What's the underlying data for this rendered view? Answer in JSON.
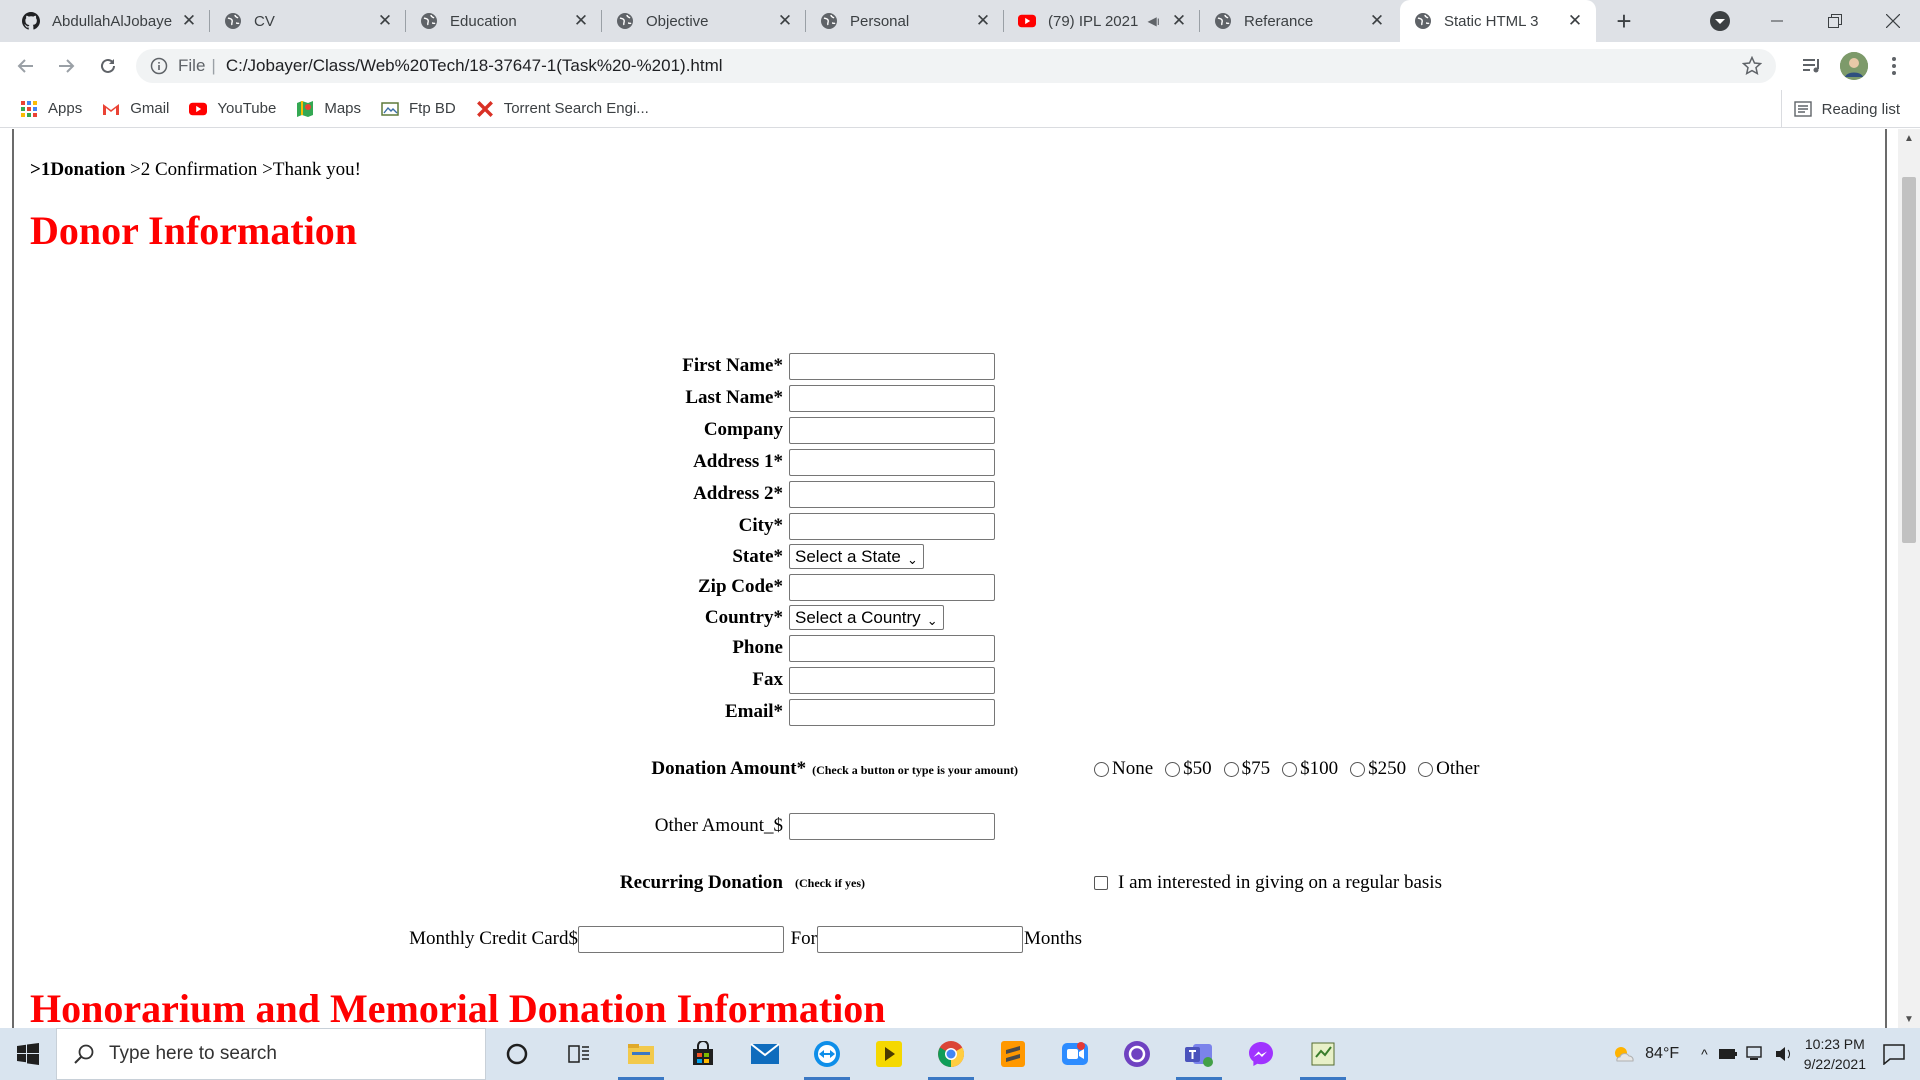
{
  "browser": {
    "tabs": [
      {
        "title": "AbdullahAlJobaye",
        "icon": "github-icon",
        "active": false
      },
      {
        "title": "CV",
        "icon": "globe-icon",
        "active": false
      },
      {
        "title": "Education",
        "icon": "globe-icon",
        "active": false
      },
      {
        "title": "Objective",
        "icon": "globe-icon",
        "active": false
      },
      {
        "title": "Personal",
        "icon": "globe-icon",
        "active": false
      },
      {
        "title": "(79) IPL 2021",
        "icon": "youtube-icon",
        "active": false,
        "audio": true
      },
      {
        "title": "Referance",
        "icon": "globe-icon",
        "active": false
      },
      {
        "title": "Static HTML 3",
        "icon": "globe-icon",
        "active": true
      }
    ],
    "address": {
      "scheme_label": "File",
      "url": "C:/Jobayer/Class/Web%20Tech/18-37647-1(Task%20-%201).html"
    },
    "bookmarks": [
      {
        "label": "Apps",
        "icon": "apps-grid-icon"
      },
      {
        "label": "Gmail",
        "icon": "gmail-icon"
      },
      {
        "label": "YouTube",
        "icon": "youtube-icon"
      },
      {
        "label": "Maps",
        "icon": "maps-icon"
      },
      {
        "label": "Ftp BD",
        "icon": "ftp-icon"
      },
      {
        "label": "Torrent Search Engi...",
        "icon": "torrent-x-icon"
      }
    ],
    "reading_list_label": "Reading list"
  },
  "page": {
    "breadcrumb": {
      "step1": ">1Donation",
      "step2": " >2 Confirmation",
      "step3": " >Thank you!"
    },
    "heading1": "Donor Information",
    "fields": [
      {
        "label": "First Name*",
        "type": "text",
        "value": ""
      },
      {
        "label": "Last Name*",
        "type": "text",
        "value": ""
      },
      {
        "label": "Company",
        "type": "text",
        "value": ""
      },
      {
        "label": "Address 1*",
        "type": "text",
        "value": ""
      },
      {
        "label": "Address 2*",
        "type": "text",
        "value": ""
      },
      {
        "label": "City*",
        "type": "text",
        "value": ""
      },
      {
        "label": "State*",
        "type": "select",
        "value": "Select a State"
      },
      {
        "label": "Zip Code*",
        "type": "text",
        "value": ""
      },
      {
        "label": "Country*",
        "type": "select",
        "value": "Select a Country"
      },
      {
        "label": "Phone",
        "type": "text",
        "value": ""
      },
      {
        "label": "Fax",
        "type": "text",
        "value": ""
      },
      {
        "label": "Email*",
        "type": "text",
        "value": ""
      }
    ],
    "donation_amount": {
      "label": "Donation Amount*",
      "note": "(Check a button or type is your amount)",
      "options": [
        "None",
        "$50",
        "$75",
        "$100",
        "$250",
        "Other"
      ]
    },
    "other_amount": {
      "label": "Other Amount_$",
      "value": ""
    },
    "recurring": {
      "label": "Recurring Donation",
      "note": "(Check if yes)",
      "checkbox_label": "I am interested in giving on a regular basis",
      "checked": false
    },
    "monthly": {
      "label": "Monthly Credit Card$",
      "for_label": "For",
      "months_label": "Months",
      "amount": "",
      "months": ""
    },
    "heading2": "Honorarium and Memorial Donation Information"
  },
  "taskbar": {
    "search_placeholder": "Type here to search",
    "apps": [
      "cortana-icon",
      "task-view-icon",
      "file-explorer-icon",
      "store-icon",
      "mail-icon",
      "teamviewer-icon",
      "kmplayer-icon",
      "chrome-icon",
      "sublime-text-icon",
      "zoom-icon",
      "github-desktop-icon",
      "teams-icon",
      "messenger-icon",
      "notepad-icon"
    ],
    "weather": "84°F",
    "time": "10:23 PM",
    "date": "9/22/2021"
  },
  "colors": {
    "heading_red": "#ff0000",
    "chrome_frame": "#dee1e6",
    "taskbar": "#d9e4ef"
  }
}
